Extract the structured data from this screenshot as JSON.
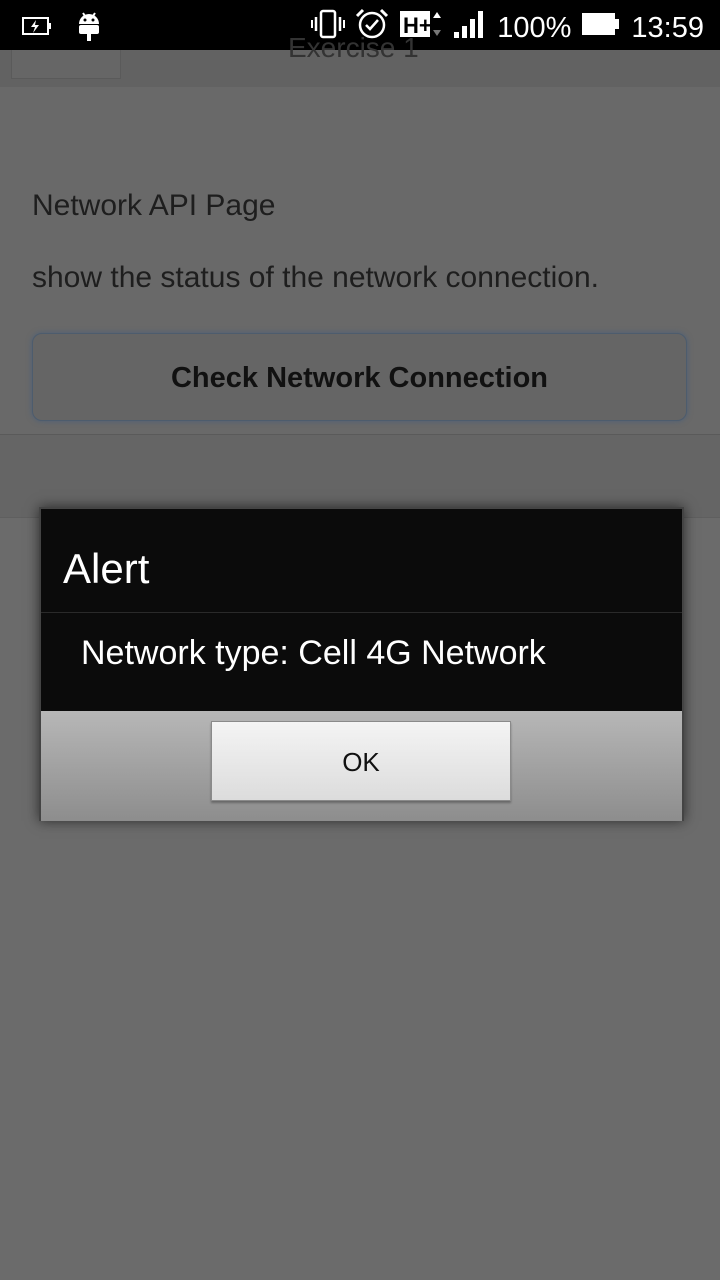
{
  "status_bar": {
    "battery_percent": "100%",
    "time": "13:59",
    "network_type": "H+",
    "icons": [
      "battery-charging-icon",
      "android-debug-icon",
      "vibrate-icon",
      "alarm-icon",
      "h-plus-network-icon",
      "signal-strength-icon",
      "battery-icon"
    ]
  },
  "page": {
    "header_title": "Exercise 1",
    "line1": "Network API Page",
    "line2": "show the status of the network connection.",
    "check_button_label": "Check Network Connection"
  },
  "dialog": {
    "title": "Alert",
    "message": "Network type: Cell 4G Network",
    "ok_label": "OK"
  },
  "colors": {
    "overlay_bg": "#6b6b6b",
    "dialog_bg": "#0b0b0b",
    "status_bar_bg": "#000000"
  }
}
